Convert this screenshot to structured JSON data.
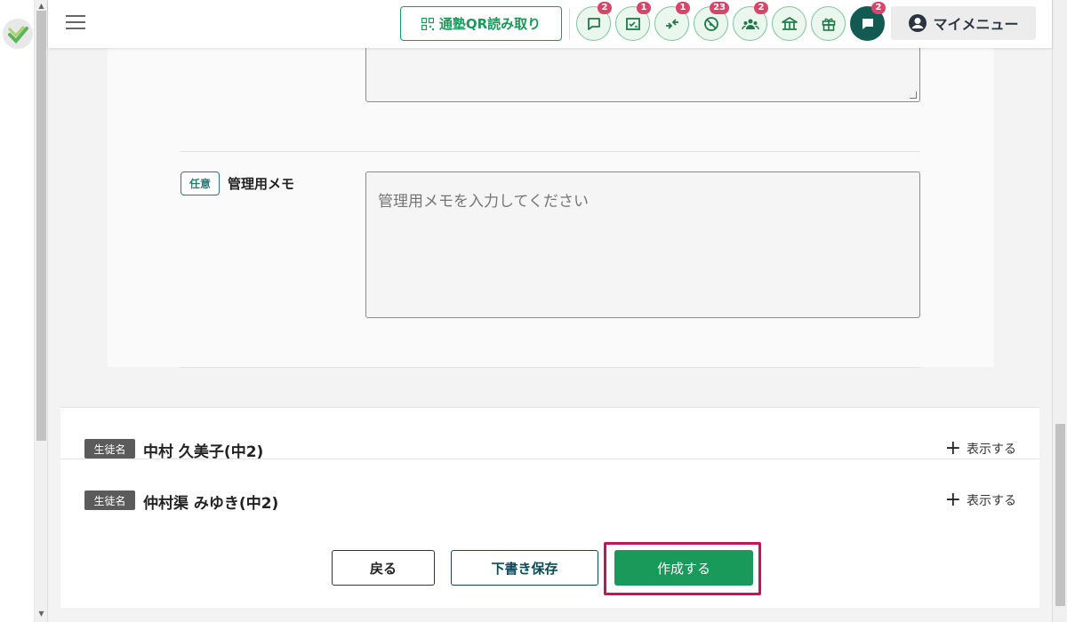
{
  "header": {
    "qr_button_label": "通塾QR読み取り",
    "nav_badges": {
      "messages": "2",
      "tasks": "1",
      "transfer": "1",
      "absence": "23",
      "groups": "2",
      "chat": "2"
    },
    "my_menu_label": "マイメニュー"
  },
  "form": {
    "optional_label": "任意",
    "memo_label": "管理用メモ",
    "memo_placeholder": "管理用メモを入力してください"
  },
  "students": [
    {
      "tag": "生徒名",
      "name": "中村 久美子(中2)",
      "toggle_label": "表示する"
    },
    {
      "tag": "生徒名",
      "name": "仲村渠 みゆき(中2)",
      "toggle_label": "表示する"
    }
  ],
  "footer": {
    "back_label": "戻る",
    "draft_label": "下書き保存",
    "create_label": "作成する"
  },
  "colors": {
    "accent_green": "#1a9a5a",
    "dark_teal": "#135a52",
    "badge_pink": "#d8456a",
    "highlight_magenta": "#c4145c"
  }
}
